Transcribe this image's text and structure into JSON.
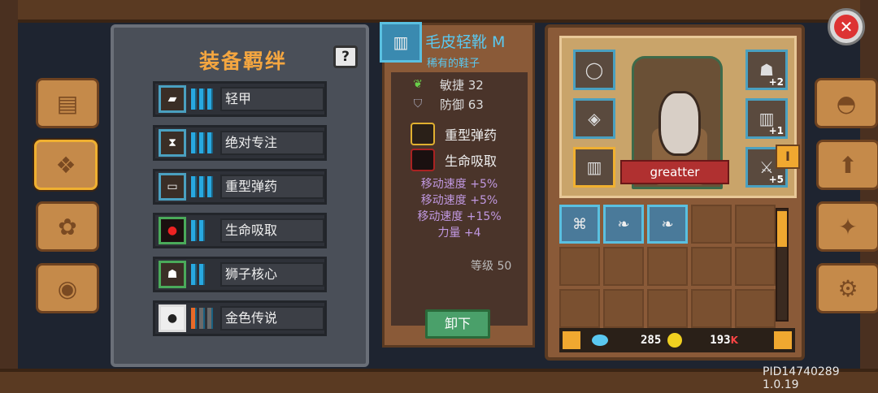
{
  "set_panel": {
    "title": "装备羁绊",
    "help": "?",
    "sets": [
      {
        "label": "轻甲",
        "icon": "green-armor-icon",
        "tier": "blue"
      },
      {
        "label": "绝对专注",
        "icon": "hourglass-icon",
        "tier": "blue"
      },
      {
        "label": "重型弹药",
        "icon": "heavy-ammo-icon",
        "tier": "blue"
      },
      {
        "label": "生命吸取",
        "icon": "life-steal-icon",
        "tier": "blue"
      },
      {
        "label": "狮子核心",
        "icon": "lion-core-icon",
        "tier": "blue"
      },
      {
        "label": "金色传说",
        "icon": "bomb-icon",
        "tier": "orange"
      }
    ]
  },
  "detail": {
    "name": "毛皮轻靴 M",
    "subtitle": "稀有的鞋子",
    "stats": [
      {
        "label": "敏捷 32",
        "icon": "leaf-icon"
      },
      {
        "label": "防御 63",
        "icon": "shield-icon"
      }
    ],
    "set_tags": [
      {
        "label": "重型弹药",
        "icon": "heavy-ammo-icon"
      },
      {
        "label": "生命吸取",
        "icon": "life-steal-icon"
      }
    ],
    "bonuses": [
      "移动速度 +5%",
      "移动速度 +5%",
      "移动速度 +15%",
      "力量 +4"
    ],
    "level": "等级 50",
    "unequip": "卸下"
  },
  "inventory": {
    "hero_name": "greatter",
    "slots_left": [
      {
        "icon": "ring-icon"
      },
      {
        "icon": "amulet-icon"
      },
      {
        "icon": "boots-icon"
      }
    ],
    "slots_right": [
      {
        "icon": "mask-icon",
        "plus": "+2"
      },
      {
        "icon": "bracer-icon",
        "plus": "+1"
      },
      {
        "icon": "weapon-icon",
        "plus": "+5"
      }
    ],
    "grid_items": [
      {
        "icon": "scroll-icon"
      },
      {
        "icon": "feather-icon"
      },
      {
        "icon": "feather-icon"
      }
    ],
    "gems": "285",
    "gold": "193",
    "gold_suffix": "K",
    "edge_tab": "I"
  },
  "pid": "PID14740289 1.0.19"
}
